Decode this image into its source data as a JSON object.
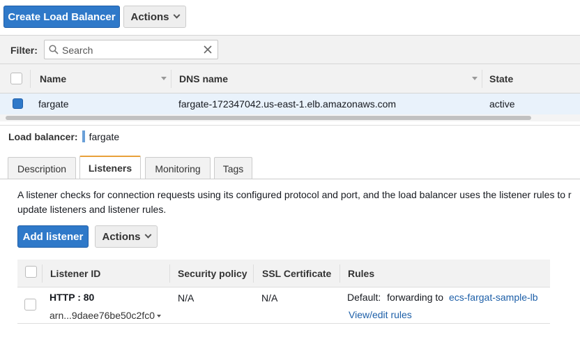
{
  "toolbar": {
    "create_label": "Create Load Balancer",
    "actions_label": "Actions"
  },
  "filter": {
    "label": "Filter:",
    "placeholder": "Search"
  },
  "lb_table": {
    "columns": [
      "Name",
      "DNS name",
      "State"
    ],
    "rows": [
      {
        "name": "fargate",
        "dns": "fargate-172347042.us-east-1.elb.amazonaws.com",
        "state": "active",
        "selected": true
      }
    ]
  },
  "detail": {
    "label": "Load balancer:",
    "name": "fargate"
  },
  "tabs": [
    {
      "label": "Description",
      "active": false
    },
    {
      "label": "Listeners",
      "active": true
    },
    {
      "label": "Monitoring",
      "active": false
    },
    {
      "label": "Tags",
      "active": false
    }
  ],
  "listeners": {
    "description_line1": "A listener checks for connection requests using its configured protocol and port, and the load balancer uses the listener rules to r",
    "description_line2": "update listeners and listener rules.",
    "add_label": "Add listener",
    "actions_label": "Actions",
    "columns": [
      "Listener ID",
      "Security policy",
      "SSL Certificate",
      "Rules"
    ],
    "rows": [
      {
        "id": "HTTP : 80",
        "arn": "arn...9daee76be50c2fc0",
        "security_policy": "N/A",
        "ssl_certificate": "N/A",
        "rules_prefix": "Default:",
        "rules_text": "forwarding to",
        "rules_target": "ecs-fargat-sample-lb",
        "view_rules": "View/edit rules"
      }
    ]
  },
  "colors": {
    "primary": "#2f79c9",
    "link": "#1d5fa8",
    "selected_row": "#e9f2fb",
    "tab_accent": "#e8a13a"
  }
}
